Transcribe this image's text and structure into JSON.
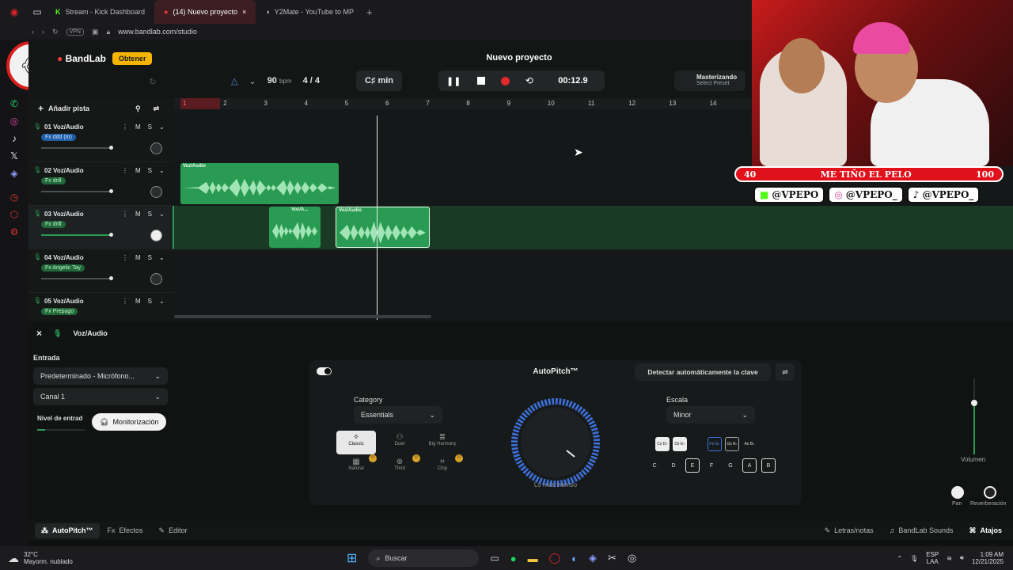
{
  "browser": {
    "tabs": [
      {
        "label": "Stream - Kick Dashboard",
        "icon": "kick-icon",
        "color": "#53fc18"
      },
      {
        "label": "(14) Nuevo proyecto",
        "icon": "bandlab-icon",
        "color": "#f03a3a"
      },
      {
        "label": "Y2Mate - YouTube to MP",
        "icon": "y2mate-icon",
        "color": "#e8e8e8"
      }
    ],
    "url": "www.bandlab.com/studio",
    "vpn_label": "VPN"
  },
  "app": {
    "logo": "BandLab",
    "get_label": "Obtener",
    "project_title": "Nuevo proyecto",
    "bpm_value": "90",
    "bpm_unit": "bpm",
    "time_sig": "4 / 4",
    "key": "C♯ min",
    "time": "00:12.9",
    "mastering_label": "Masterizando",
    "mastering_sub": "Select Preset",
    "add_track_label": "Añadir pista",
    "accent": "#2a9b52",
    "record_color": "#e0282d"
  },
  "tracks": [
    {
      "name": "01  Voz/Audio",
      "fx": "Fx  ddd (m)",
      "fx_color": "#1e5fa8"
    },
    {
      "name": "02  Voz/Audio",
      "fx": "Fx drill",
      "fx_color": "#21683a"
    },
    {
      "name": "03  Voz/Audio",
      "fx": "Fx drill",
      "fx_color": "#21683a"
    },
    {
      "name": "04  Voz/Audio",
      "fx": "Fx Angelic Tay",
      "fx_color": "#21683a"
    },
    {
      "name": "05  Voz/Audio",
      "fx": "Fx Prepago",
      "fx_color": "#21683a"
    }
  ],
  "track_btn_labels": [
    "M",
    "S"
  ],
  "ruler": [
    "1",
    "2",
    "3",
    "4",
    "5",
    "6",
    "7",
    "8",
    "9",
    "10",
    "11",
    "12",
    "13",
    "14"
  ],
  "clips": [
    {
      "label": "Voz/Audio"
    },
    {
      "label": "Voz/A..."
    },
    {
      "label": "Voz/Audio"
    }
  ],
  "inspector": {
    "track_label": "Voz/Audio",
    "entrada_label": "Entrada",
    "input_device": "Predeterminado - Micrófono...",
    "channel": "Canal 1",
    "level_label": "Nivel de entrad",
    "monitor_label": "Monitorización"
  },
  "autopitch": {
    "title": "AutoPitch™",
    "detect_label": "Detectar automáticamente la clave",
    "category_label": "Category",
    "category_value": "Essentials",
    "presets": [
      "Classic",
      "Duet",
      "Big Harmony",
      "Natural",
      "Third",
      "Chip"
    ],
    "knob_caption": "Lo más intenso",
    "scale_label": "Escala",
    "scale_value": "Minor",
    "accidental_keys": [
      "C♯ D♭",
      "D♯ E♭",
      "F♯ G♭",
      "G♯ A♭",
      "A♯ B♭"
    ],
    "natural_keys": [
      "C",
      "D",
      "E",
      "F",
      "G",
      "A",
      "B"
    ]
  },
  "mixer": {
    "volume_label": "Volumen",
    "pan_label": "Pan",
    "reverb_label": "Reverberación"
  },
  "footer": {
    "tabs": [
      "AutoPitch™",
      "Efectos",
      "Editor"
    ],
    "right": [
      "Letras/notas",
      "BandLab Sounds",
      "Atajos"
    ]
  },
  "stream": {
    "counter_left": "40",
    "bar_text": "ME TIÑO EL PELO",
    "counter_right": "100",
    "socials": [
      "@VPEPO",
      "@VPEPO_",
      "@VPEPO_"
    ]
  },
  "taskbar": {
    "weather_temp": "32°C",
    "weather_desc": "Mayorm. nublado",
    "search_label": "Buscar",
    "lang": "ESP",
    "lang2": "LAA",
    "time": "1:09 AM",
    "date": "12/21/2025"
  }
}
